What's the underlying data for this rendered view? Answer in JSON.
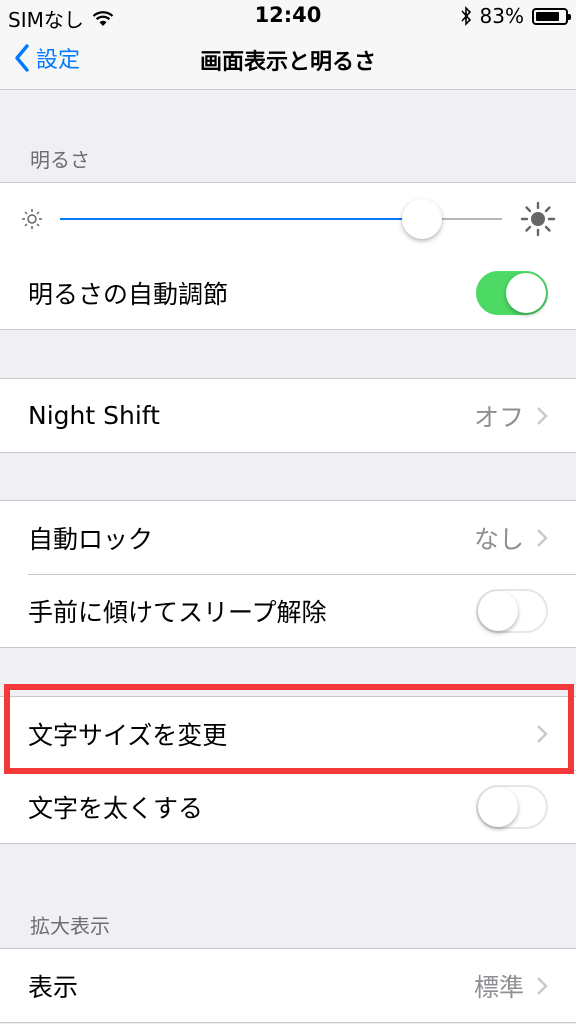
{
  "status": {
    "carrier": "SIMなし",
    "time": "12:40",
    "battery": "83%",
    "battery_level": 0.83
  },
  "nav": {
    "back_label": "設定",
    "title": "画面表示と明るさ"
  },
  "brightness": {
    "header": "明るさ",
    "level": 0.82,
    "auto_label": "明るさの自動調節",
    "auto_on": true
  },
  "night_shift": {
    "label": "Night Shift",
    "value": "オフ"
  },
  "lock": {
    "auto_lock_label": "自動ロック",
    "auto_lock_value": "なし",
    "raise_to_wake_label": "手前に傾けてスリープ解除",
    "raise_to_wake_on": false
  },
  "text": {
    "text_size_label": "文字サイズを変更",
    "bold_label": "文字を太くする",
    "bold_on": false
  },
  "zoom": {
    "header": "拡大表示",
    "view_label": "表示",
    "view_value": "標準"
  },
  "colors": {
    "accent": "#007aff",
    "toggle_on": "#4cd964",
    "highlight": "#f23838"
  }
}
